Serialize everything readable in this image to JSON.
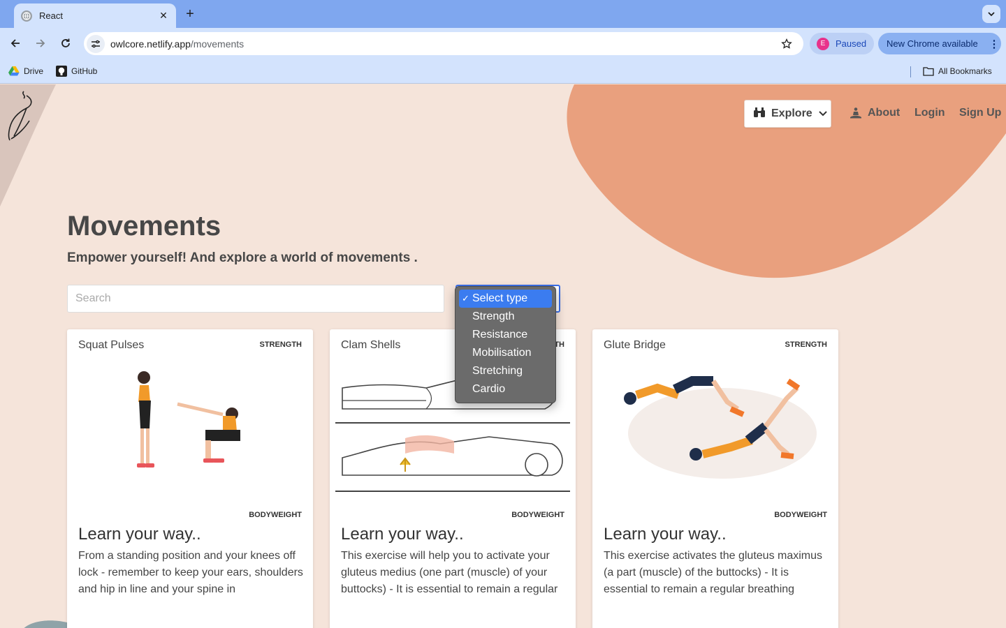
{
  "browser": {
    "tab_title": "React",
    "url_host": "owlcore.netlify.app",
    "url_path": "/movements",
    "profile_initial": "E",
    "profile_status": "Paused",
    "update_label": "New Chrome available",
    "bookmarks": [
      {
        "label": "Drive",
        "icon": "drive-icon"
      },
      {
        "label": "GitHub",
        "icon": "github-icon"
      }
    ],
    "all_bookmarks_label": "All Bookmarks"
  },
  "nav": {
    "explore_label": "Explore",
    "about_label": "About",
    "login_label": "Login",
    "signup_label": "Sign Up"
  },
  "header": {
    "title": "Movements",
    "subtitle": "Empower yourself! And explore a world of movements ."
  },
  "search": {
    "placeholder": "Search",
    "value": ""
  },
  "type_select": {
    "selected": "Select type",
    "options": [
      "Select type",
      "Strength",
      "Resistance",
      "Mobilisation",
      "Stretching",
      "Cardio"
    ]
  },
  "cards": [
    {
      "title": "Squat Pulses",
      "type": "STRENGTH",
      "equipment": "BODYWEIGHT",
      "heading": "Learn your way..",
      "description": "From a standing position and your knees off lock - remember to keep your ears, shoulders and hip in line and your spine in"
    },
    {
      "title": "Clam Shells",
      "type": "STRENGTH",
      "equipment": "BODYWEIGHT",
      "heading": "Learn your way..",
      "description": "This exercise will help you to activate your gluteus medius (one part (muscle) of your buttocks) - It is essential to remain a regular"
    },
    {
      "title": "Glute Bridge",
      "type": "STRENGTH",
      "equipment": "BODYWEIGHT",
      "heading": "Learn your way..",
      "description": "This exercise activates the gluteus maximus (a part (muscle) of the buttocks) - It is essential to remain a regular breathing"
    }
  ],
  "colors": {
    "page_bg": "#f5e4da",
    "blob": "#e9a07e",
    "accent_blue": "#3b7cf0"
  }
}
